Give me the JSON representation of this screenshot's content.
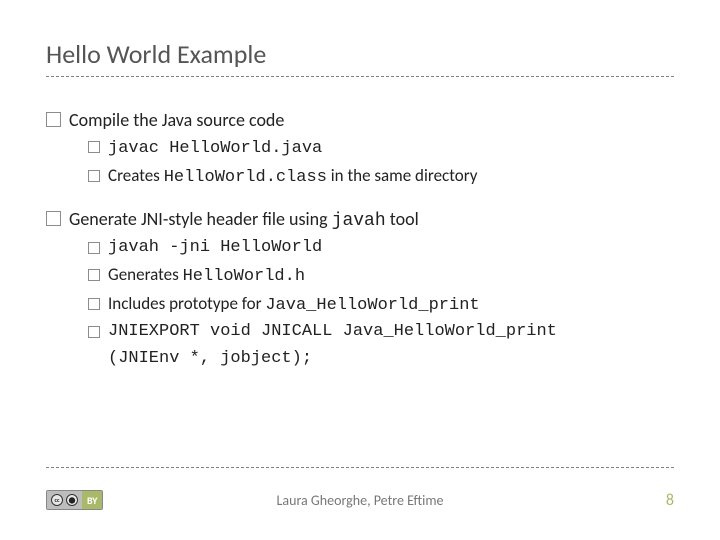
{
  "title": "Hello World Example",
  "sections": [
    {
      "head": {
        "pre": "Compile the Java source code",
        "mono": ""
      },
      "items": [
        {
          "text": "",
          "mono": "javac HelloWorld.java"
        },
        {
          "text": "Creates ",
          "mono": "HelloWorld.class",
          "post": " in the same directory"
        }
      ]
    },
    {
      "head": {
        "pre": "Generate JNI-style header file using ",
        "mono": "javah",
        "post": " tool"
      },
      "items": [
        {
          "text": "",
          "mono": "javah -jni HelloWorld"
        },
        {
          "text": "Generates ",
          "mono": "HelloWorld.h"
        },
        {
          "text": "Includes prototype for ",
          "mono": "Java_HelloWorld_print"
        },
        {
          "text": "",
          "mono": "JNIEXPORT void JNICALL Java_HelloWorld_print",
          "cont": "(JNIEnv *, jobject);"
        }
      ]
    }
  ],
  "footer": {
    "cc_left": "CC",
    "cc_right": "BY",
    "authors": "Laura Gheorghe, Petre Eftime",
    "page": "8"
  }
}
